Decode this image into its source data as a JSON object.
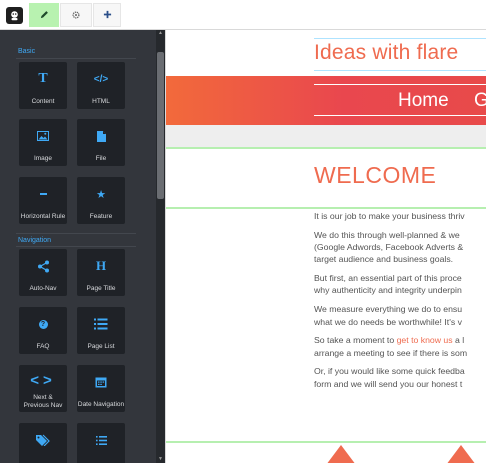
{
  "toolbar": {
    "tabs": [
      {
        "icon": "pencil-icon",
        "state": "active"
      },
      {
        "icon": "gear-icon",
        "state": "inactive"
      },
      {
        "icon": "plus-icon",
        "state": "inactive"
      }
    ]
  },
  "sidebar": {
    "sections": [
      {
        "title": "Basic",
        "widgets": [
          {
            "label": "Content",
            "icon": "text-T-icon"
          },
          {
            "label": "HTML",
            "icon": "code-icon"
          },
          {
            "label": "Image",
            "icon": "image-icon"
          },
          {
            "label": "File",
            "icon": "file-icon"
          },
          {
            "label": "Horizontal Rule",
            "icon": "minus-icon"
          },
          {
            "label": "Feature",
            "icon": "star-icon"
          }
        ]
      },
      {
        "title": "Navigation",
        "widgets": [
          {
            "label": "Auto-Nav",
            "icon": "share-icon"
          },
          {
            "label": "Page Title",
            "icon": "heading-H-icon"
          },
          {
            "label": "FAQ",
            "icon": "question-icon"
          },
          {
            "label": "Page List",
            "icon": "list-icon"
          },
          {
            "label_line1": "Next &",
            "label_line2": "Previous Nav",
            "icon": "chevrons-icon"
          },
          {
            "label": "Date Navigation",
            "icon": "calendar-icon"
          },
          {
            "label": "",
            "icon": "tags-icon"
          },
          {
            "label": "",
            "icon": "list-icon"
          }
        ]
      }
    ]
  },
  "preview": {
    "site_title": "Ideas with flare",
    "nav": [
      "Home",
      "G"
    ],
    "heading": "WELCOME",
    "paragraphs": [
      "It is our job to make your business thriv",
      "We do this through well-planned & we",
      "(Google Adwords, Facebook Adverts &",
      "target audience and business goals.",
      "But first, an essential part of this proce",
      "why authenticity and integrity underpin",
      "We measure everything we do to ensu",
      "what we do needs be worthwhile! It's v",
      "So take a moment to ",
      "get to know us",
      " a l",
      "arrange a meeting to see if there is som",
      "Or, if you would like some quick feedba",
      "form and we will send you our honest t"
    ]
  },
  "colors": {
    "accent": "#ef6b4f",
    "sidebar_bg": "#33363c",
    "widget_bg": "#1f2227",
    "section_title": "#3fa9f5",
    "active_tab": "#b8f2b0"
  }
}
